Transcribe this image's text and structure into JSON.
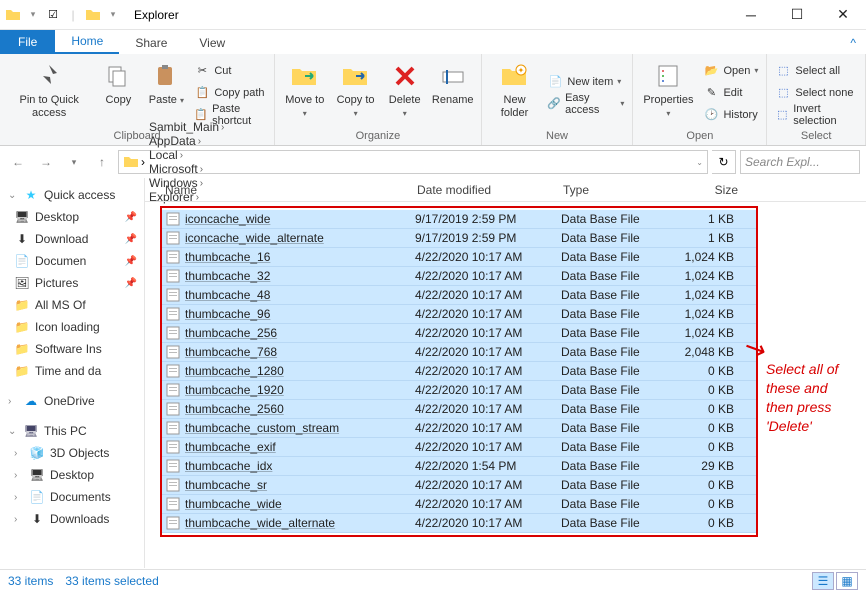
{
  "window": {
    "title": "Explorer"
  },
  "tabs": {
    "file": "File",
    "home": "Home",
    "share": "Share",
    "view": "View"
  },
  "ribbon": {
    "pin": "Pin to Quick access",
    "copy": "Copy",
    "paste": "Paste",
    "cut": "Cut",
    "copypath": "Copy path",
    "pasteshort": "Paste shortcut",
    "clipboard": "Clipboard",
    "moveto": "Move to",
    "copyto": "Copy to",
    "delete": "Delete",
    "rename": "Rename",
    "organize": "Organize",
    "newfolder": "New folder",
    "newitem": "New item",
    "easyaccess": "Easy access",
    "new": "New",
    "properties": "Properties",
    "open": "Open",
    "edit": "Edit",
    "history": "History",
    "opengrp": "Open",
    "selall": "Select all",
    "selnone": "Select none",
    "invsel": "Invert selection",
    "select": "Select"
  },
  "breadcrumbs": [
    "Sambit_Main",
    "AppData",
    "Local",
    "Microsoft",
    "Windows",
    "Explorer"
  ],
  "search_placeholder": "Search Expl...",
  "nav": {
    "quick": "Quick access",
    "items": [
      "Desktop",
      "Download",
      "Documen",
      "Pictures",
      "All MS Of",
      "Icon loading",
      "Software Ins",
      "Time and da"
    ],
    "onedrive": "OneDrive",
    "thispc": "This PC",
    "pc": [
      "3D Objects",
      "Desktop",
      "Documents",
      "Downloads"
    ]
  },
  "columns": {
    "name": "Name",
    "date": "Date modified",
    "type": "Type",
    "size": "Size"
  },
  "files": [
    {
      "n": "iconcache_wide",
      "d": "9/17/2019 2:59 PM",
      "t": "Data Base File",
      "s": "1 KB"
    },
    {
      "n": "iconcache_wide_alternate",
      "d": "9/17/2019 2:59 PM",
      "t": "Data Base File",
      "s": "1 KB"
    },
    {
      "n": "thumbcache_16",
      "d": "4/22/2020 10:17 AM",
      "t": "Data Base File",
      "s": "1,024 KB"
    },
    {
      "n": "thumbcache_32",
      "d": "4/22/2020 10:17 AM",
      "t": "Data Base File",
      "s": "1,024 KB"
    },
    {
      "n": "thumbcache_48",
      "d": "4/22/2020 10:17 AM",
      "t": "Data Base File",
      "s": "1,024 KB"
    },
    {
      "n": "thumbcache_96",
      "d": "4/22/2020 10:17 AM",
      "t": "Data Base File",
      "s": "1,024 KB"
    },
    {
      "n": "thumbcache_256",
      "d": "4/22/2020 10:17 AM",
      "t": "Data Base File",
      "s": "1,024 KB"
    },
    {
      "n": "thumbcache_768",
      "d": "4/22/2020 10:17 AM",
      "t": "Data Base File",
      "s": "2,048 KB"
    },
    {
      "n": "thumbcache_1280",
      "d": "4/22/2020 10:17 AM",
      "t": "Data Base File",
      "s": "0 KB"
    },
    {
      "n": "thumbcache_1920",
      "d": "4/22/2020 10:17 AM",
      "t": "Data Base File",
      "s": "0 KB"
    },
    {
      "n": "thumbcache_2560",
      "d": "4/22/2020 10:17 AM",
      "t": "Data Base File",
      "s": "0 KB"
    },
    {
      "n": "thumbcache_custom_stream",
      "d": "4/22/2020 10:17 AM",
      "t": "Data Base File",
      "s": "0 KB"
    },
    {
      "n": "thumbcache_exif",
      "d": "4/22/2020 10:17 AM",
      "t": "Data Base File",
      "s": "0 KB"
    },
    {
      "n": "thumbcache_idx",
      "d": "4/22/2020 1:54 PM",
      "t": "Data Base File",
      "s": "29 KB"
    },
    {
      "n": "thumbcache_sr",
      "d": "4/22/2020 10:17 AM",
      "t": "Data Base File",
      "s": "0 KB"
    },
    {
      "n": "thumbcache_wide",
      "d": "4/22/2020 10:17 AM",
      "t": "Data Base File",
      "s": "0 KB"
    },
    {
      "n": "thumbcache_wide_alternate",
      "d": "4/22/2020 10:17 AM",
      "t": "Data Base File",
      "s": "0 KB"
    }
  ],
  "annotation": "Select all of these and then press 'Delete'",
  "status": {
    "count": "33 items",
    "sel": "33 items selected"
  }
}
